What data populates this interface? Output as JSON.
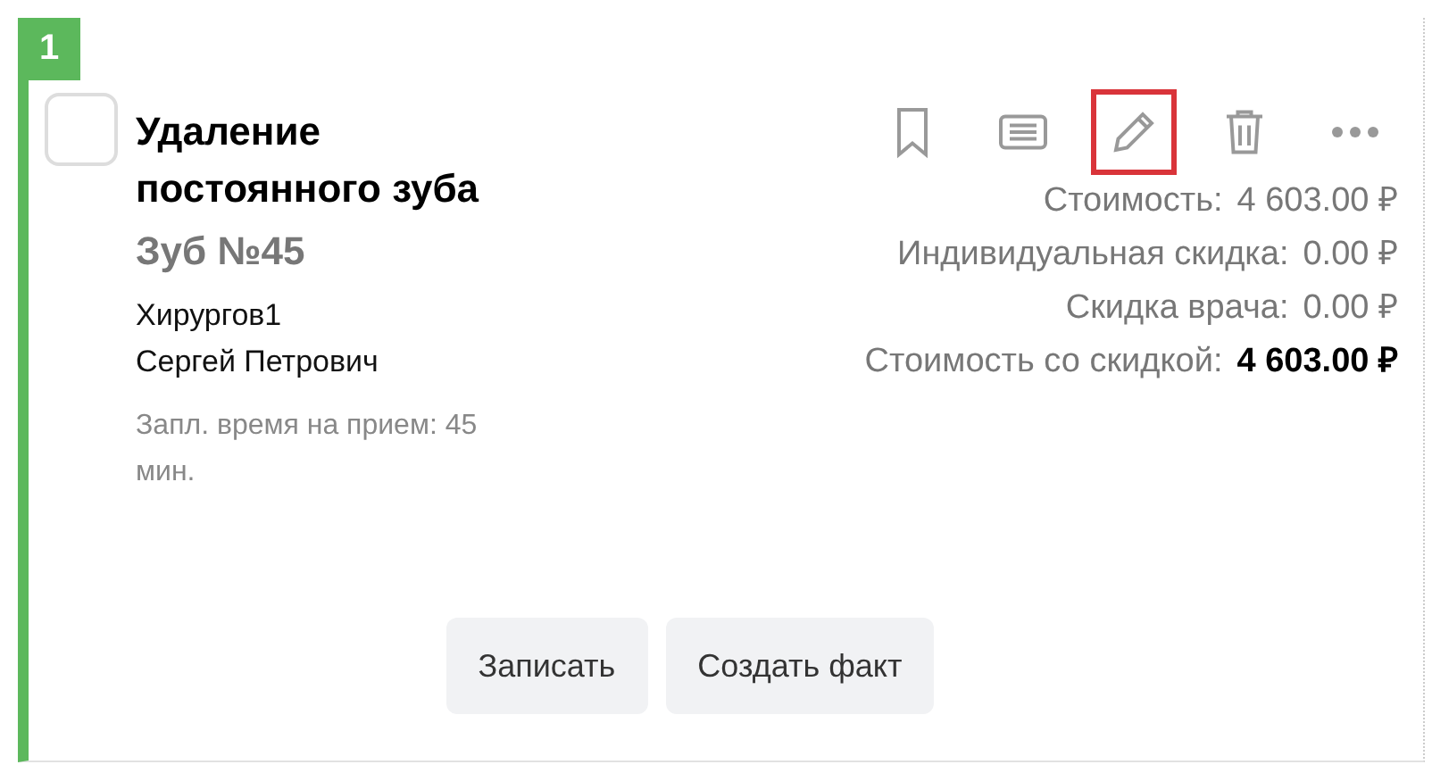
{
  "card": {
    "number": "1",
    "checked": false,
    "title": "Удаление постоянного зуба",
    "tooth": "Зуб №45",
    "doctor": [
      "Хирургов1",
      "Сергей Петрович"
    ],
    "planned_time": "Запл. время на прием: 45 мин.",
    "actions": [
      {
        "kind": "bookmark",
        "highlighted": false
      },
      {
        "kind": "list",
        "highlighted": false
      },
      {
        "kind": "edit",
        "highlighted": true
      },
      {
        "kind": "delete",
        "highlighted": false
      },
      {
        "kind": "more",
        "highlighted": false
      }
    ],
    "prices": [
      {
        "label": "Стоимость:",
        "value": "4 603.00 ₽",
        "bold": false
      },
      {
        "label": "Индивидуальная скидка:",
        "value": "0.00 ₽",
        "bold": false
      },
      {
        "label": "Скидка врача:",
        "value": "0.00 ₽",
        "bold": false
      },
      {
        "label": "Стоимость со скидкой:",
        "value": "4 603.00 ₽",
        "bold": true
      }
    ],
    "buttons": [
      "Записать",
      "Создать факт"
    ]
  }
}
